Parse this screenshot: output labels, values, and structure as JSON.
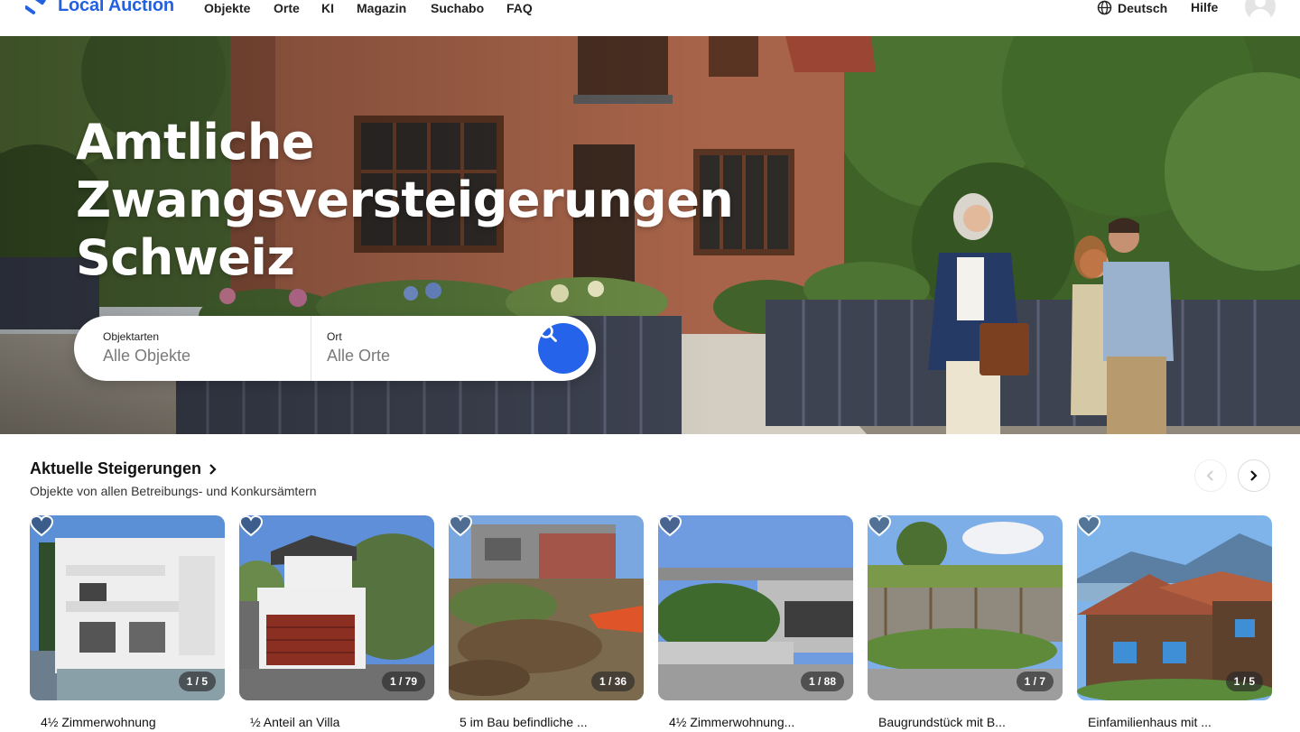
{
  "header": {
    "logo_text": "Local Auction",
    "nav": [
      "Objekte",
      "Orte",
      "KI",
      "Magazin",
      "Suchabo",
      "FAQ"
    ],
    "language": "Deutsch",
    "help": "Hilfe",
    "icons": {
      "logo": "gavel-icon",
      "language": "globe-icon",
      "avatar": "user-avatar-icon"
    }
  },
  "hero": {
    "title_lines": [
      "Amtliche",
      "Zwangsversteigerungen",
      "Schweiz"
    ],
    "search": {
      "type_label": "Objektarten",
      "type_placeholder": "Alle Objekte",
      "place_label": "Ort",
      "place_placeholder": "Alle Orte",
      "button_icon": "search-icon"
    }
  },
  "section": {
    "title": "Aktuelle Steigerungen",
    "subtitle": "Objekte von allen Betreibungs- und Konkursämtern"
  },
  "cards": [
    {
      "counter": "1 / 5",
      "title": "4½ Zimmerwohnung"
    },
    {
      "counter": "1 / 79",
      "title": "½ Anteil an Villa"
    },
    {
      "counter": "1 / 36",
      "title": "5 im Bau befindliche ..."
    },
    {
      "counter": "1 / 88",
      "title": "4½ Zimmerwohnung..."
    },
    {
      "counter": "1 / 7",
      "title": "Baugrundstück mit B..."
    },
    {
      "counter": "1 / 5",
      "title": "Einfamilienhaus mit ..."
    }
  ],
  "colors": {
    "brand": "#2461e0",
    "search_button": "#2563eb"
  }
}
